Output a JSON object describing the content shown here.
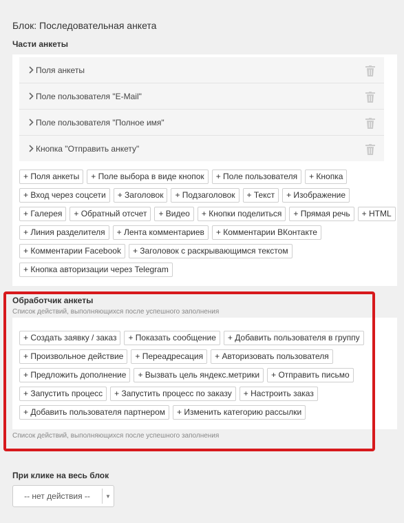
{
  "block_title": "Блок: Последовательная анкета",
  "parts": {
    "title": "Части анкеты",
    "items": [
      {
        "label": "Поля анкеты"
      },
      {
        "label": "Поле пользователя \"E-Mail\""
      },
      {
        "label": "Поле пользователя \"Полное имя\""
      },
      {
        "label": "Кнопка \"Отправить анкету\""
      }
    ],
    "add_buttons": [
      [
        "+ Поля анкеты",
        "+ Поле выбора в виде кнопок",
        "+ Поле пользователя",
        "+ Кнопка"
      ],
      [
        "+ Вход через соцсети",
        "+ Заголовок",
        "+ Подзаголовок",
        "+ Текст",
        "+ Изображение"
      ],
      [
        "+ Галерея",
        "+ Обратный отсчет",
        "+ Видео",
        "+ Кнопки поделиться",
        "+ Прямая речь",
        "+ HTML"
      ],
      [
        "+ Линия разделителя",
        "+ Лента комментариев",
        "+ Комментарии ВКонтакте"
      ],
      [
        "+ Комментарии Facebook",
        "+ Заголовок с раскрывающимся текстом"
      ],
      [
        "+ Кнопка авторизации через Telegram"
      ]
    ]
  },
  "handler": {
    "title": "Обработчик анкеты",
    "description_top": "Список действий, выполняющихся после успешного заполнения",
    "description_bottom": "Список действий, выполняющихся после успешного заполнения",
    "actions": [
      [
        "+ Создать заявку / заказ",
        "+ Показать сообщение",
        "+ Добавить пользователя в группу"
      ],
      [
        "+ Произвольное действие",
        "+ Переадресация",
        "+ Авторизовать пользователя"
      ],
      [
        "+ Предложить дополнение",
        "+ Вызвать цель яндекс.метрики",
        "+ Отправить письмо"
      ],
      [
        "+ Запустить процесс",
        "+ Запустить процесс по заказу",
        "+ Настроить заказ"
      ],
      [
        "+ Добавить пользователя партнером",
        "+ Изменить категорию рассылки"
      ]
    ]
  },
  "click": {
    "title": "При клике на весь блок",
    "select_value": "-- нет действия --"
  },
  "colors": {
    "highlight": "#d7191c"
  },
  "icons": {
    "expand": "chevron-right-icon",
    "delete": "trash-icon",
    "dropdown": "caret-down-icon"
  }
}
